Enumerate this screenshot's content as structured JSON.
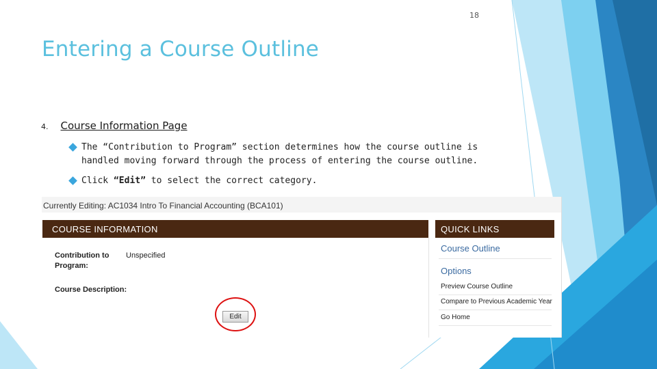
{
  "slide": {
    "number": "18",
    "title": "Entering a Course Outline",
    "section_number": "4.",
    "section_heading": "Course Information Page",
    "bullets": [
      {
        "line1": "The “Contribution to Program” section determines how the course outline is",
        "line2": "handled moving forward through the process of entering the course outline."
      },
      {
        "pre": "Click ",
        "bold": "“Edit”",
        "post": " to select the correct category."
      }
    ]
  },
  "screenshot": {
    "currently_editing": "Currently Editing: AC1034 Intro To Financial Accounting (BCA101)",
    "course_info_header": "COURSE INFORMATION",
    "contribution_label_1": "Contribution to",
    "contribution_label_2": "Program:",
    "contribution_value": "Unspecified",
    "description_label": "Course Description:",
    "edit_button": "Edit",
    "quick_links_header": "QUICK LINKS",
    "course_outline_link": "Course Outline",
    "options_link": "Options",
    "links": [
      "Preview Course Outline",
      "Compare to Previous Academic Year",
      "Go Home"
    ]
  },
  "colors": {
    "title": "#5bc0de",
    "panel_header": "#4a2812",
    "bullet": "#3aa6dd",
    "highlight_circle": "#dd1111",
    "deco_blues": [
      "#1f6fa5",
      "#2b86c4",
      "#2aa7df",
      "#7dd0f0",
      "#bde6f7"
    ]
  }
}
